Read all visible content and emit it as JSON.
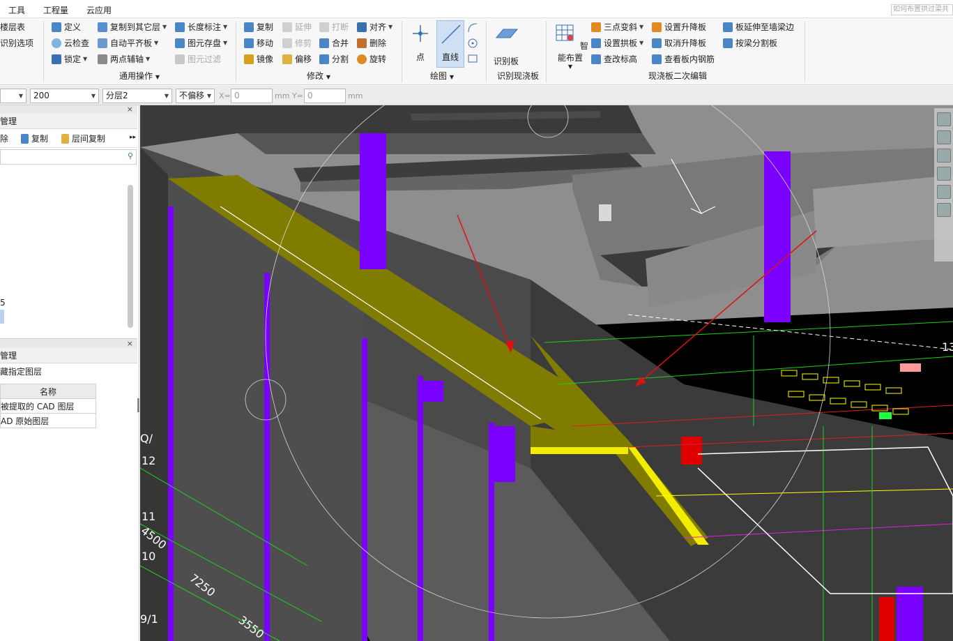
{
  "menu": {
    "items": [
      "工具",
      "工程量",
      "云应用"
    ],
    "search_placeholder": "如何布置拱过梁共"
  },
  "ribbon": {
    "floor_group": {
      "floor_table": "楼层表",
      "recognize_options": "识别选项"
    },
    "general_ops": {
      "define": "定义",
      "cloud_check": "云检查",
      "lock": "锁定",
      "copy_to_other_layer": "复制到其它层",
      "auto_flush_slab": "自动平齐板",
      "two_point_aux_axis": "两点辅轴",
      "length_dimension": "长度标注",
      "element_save": "图元存盘",
      "element_filter": "图元过滤",
      "label": "通用操作"
    },
    "modify": {
      "copy": "复制",
      "move": "移动",
      "mirror": "镜像",
      "extend": "延伸",
      "trim": "修剪",
      "offset": "偏移",
      "break": "打断",
      "merge": "合并",
      "split": "分割",
      "align": "对齐",
      "delete": "删除",
      "rotate": "旋转",
      "label": "修改"
    },
    "draw": {
      "point": "点",
      "line": "直线",
      "label": "绘图"
    },
    "recognize": {
      "recognize_slab": "识别板",
      "label": "识别现浇板"
    },
    "secondary_edit": {
      "smart_layout": "智能布置",
      "three_point_slope": "三点变斜",
      "set_arch_slab": "设置拱板",
      "change_elevation": "查改标高",
      "set_raise_lower_slab": "设置升降板",
      "cancel_raise_lower_slab": "取消升降板",
      "view_slab_rebar": "查看板内钢筋",
      "extend_slab_to_wall_beam": "板延伸至墙梁边",
      "split_by_beam": "按梁分割板",
      "label": "现浇板二次编辑"
    }
  },
  "propbar": {
    "sel1": "",
    "sel2": "200",
    "sel3": "分层2",
    "sel4": "不偏移",
    "x_label": "X=",
    "x_value": "0",
    "mm1": "mm",
    "y_label": "Y=",
    "y_value": "0",
    "mm2": "mm"
  },
  "left_panel": {
    "top": {
      "title": "管理",
      "close": "×",
      "delete": "除",
      "copy": "复制",
      "floor_copy": "层间复制",
      "tree_char": "5"
    },
    "bottom": {
      "title": "管理",
      "close": "×",
      "hide_layer": "藏指定图层",
      "col_name": "名称",
      "rows": [
        "被提取的 CAD 图层",
        "AD 原始图层"
      ]
    }
  },
  "viewport": {
    "axis_labels": [
      "Q/",
      "12",
      "11",
      "4500",
      "10",
      "7250",
      "9/1",
      "3550",
      "13"
    ]
  },
  "colors": {
    "ribbon_bg": "#f7f7f7",
    "viewport_bg": "#555555",
    "slab_yellow": "#7f7c00",
    "column_purple": "#7a00ff",
    "cad_bg": "#000000",
    "arrow_red": "#e01010"
  }
}
